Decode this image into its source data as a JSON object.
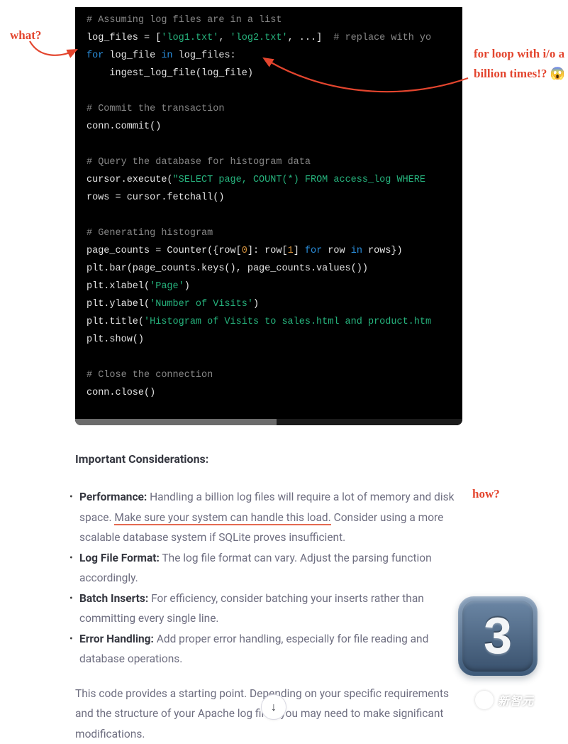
{
  "code": {
    "c1": "# Assuming log files are in a list",
    "l2a": "log_files = [",
    "l2s1": "'log1.txt'",
    "l2b": ", ",
    "l2s2": "'log2.txt'",
    "l2c": ", ...]  ",
    "l2cmt": "# replace with yo",
    "l3a": "for",
    "l3b": " log_file ",
    "l3c": "in",
    "l3d": " log_files:",
    "l4": "    ingest_log_file(log_file)",
    "c2": "# Commit the transaction",
    "l5": "conn.commit()",
    "c3": "# Query the database for histogram data",
    "l6a": "cursor.execute(",
    "l6s": "\"SELECT page, COUNT(*) FROM access_log WHERE ",
    "l7": "rows = cursor.fetchall()",
    "c4": "# Generating histogram",
    "l8a": "page_counts = Counter({row[",
    "l8n0": "0",
    "l8b": "]: row[",
    "l8n1": "1",
    "l8c": "] ",
    "l8k1": "for",
    "l8d": " row ",
    "l8k2": "in",
    "l8e": " rows})",
    "l9": "plt.bar(page_counts.keys(), page_counts.values())",
    "l10a": "plt.xlabel(",
    "l10s": "'Page'",
    "l10b": ")",
    "l11a": "plt.ylabel(",
    "l11s": "'Number of Visits'",
    "l11b": ")",
    "l12a": "plt.title(",
    "l12s": "'Histogram of Visits to sales.html and product.htm",
    "l13": "plt.show()",
    "c5": "# Close the connection",
    "l14": "conn.close()"
  },
  "article": {
    "heading": "Important Considerations:",
    "items": [
      {
        "label": "Performance:",
        "before": " Handling a billion log files will require a lot of memory and disk space. ",
        "underlined": "Make sure your system can handle this load.",
        "after": " Consider using a more scalable database system if SQLite proves insufficient."
      },
      {
        "label": "Log File Format:",
        "text": " The log file format can vary. Adjust the parsing function accordingly."
      },
      {
        "label": "Batch Inserts:",
        "text": " For efficiency, consider batching your inserts rather than committing every single line."
      },
      {
        "label": "Error Handling:",
        "text": " Add proper error handling, especially for file reading and database operations."
      }
    ],
    "closing": "This code provides a starting point. Depending on your specific requirements and the structure of your Apache log files, you may need to make significant modifications."
  },
  "annotations": {
    "what": "what?",
    "loop": "for loop with i/o a billion times!? 😱",
    "how": "how?"
  },
  "badge": {
    "number": "3"
  },
  "scroll_glyph": "↓",
  "watermark": "新智元"
}
